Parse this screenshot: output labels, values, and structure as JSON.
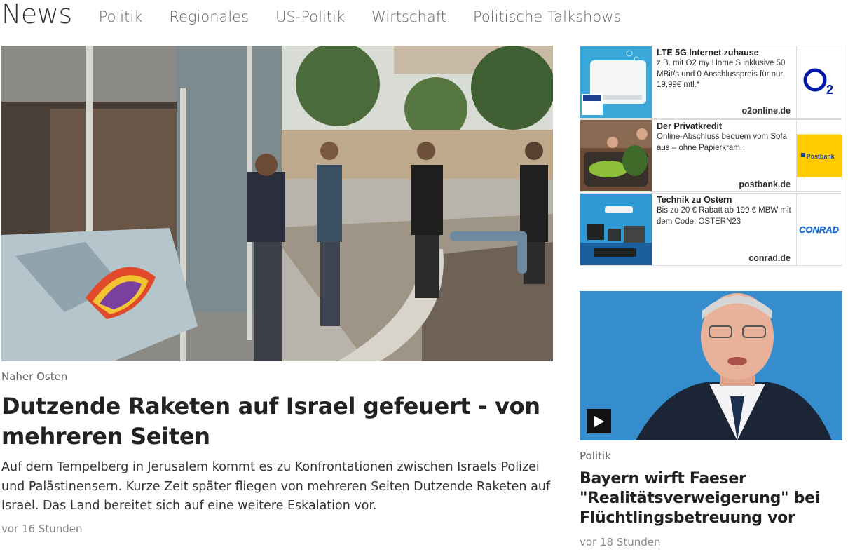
{
  "nav": {
    "brand": "News",
    "links": [
      "Politik",
      "Regionales",
      "US-Politik",
      "Wirtschaft",
      "Politische Talkshows"
    ]
  },
  "main_article": {
    "kicker": "Naher Osten",
    "headline": "Dutzende Raketen auf Israel gefeuert - von mehreren Seiten",
    "teaser": "Auf dem Tempelberg in Jerusalem kommt es zu Konfrontationen zwischen Israels Polizei und Palästinensern. Kurze Zeit später fliegen von mehreren Seiten Dutzende Raketen auf Israel. Das Land bereitet sich auf eine weitere Eskalation vor.",
    "time": "vor 16 Stunden"
  },
  "ads": [
    {
      "title": "LTE 5G Internet zuhause",
      "description": "z.B. mit O2 my Home S inklusive 50 MBit/s und 0 Anschlusspreis für nur 19,99€ mtl.*",
      "domain": "o2online.de",
      "logo_text": "O2",
      "logo_color": "#0019a5"
    },
    {
      "title": "Der Privatkredit",
      "description": "Online-Abschluss bequem vom Sofa aus – ohne Papierkram.",
      "domain": "postbank.de",
      "logo_text": "Postbank",
      "logo_color": "#ffcc00"
    },
    {
      "title": "Technik zu Ostern",
      "description": "Bis zu 20 € Rabatt ab 199 € MBW mit dem Code: OSTERN23",
      "domain": "conrad.de",
      "logo_text": "CONRAD",
      "logo_color": "#1f6fd1"
    }
  ],
  "side_article": {
    "kicker": "Politik",
    "headline": "Bayern wirft Faeser \"Realitätsverweigerung\" bei Flüchtlingsbetreuung vor",
    "time": "vor 18 Stunden"
  }
}
